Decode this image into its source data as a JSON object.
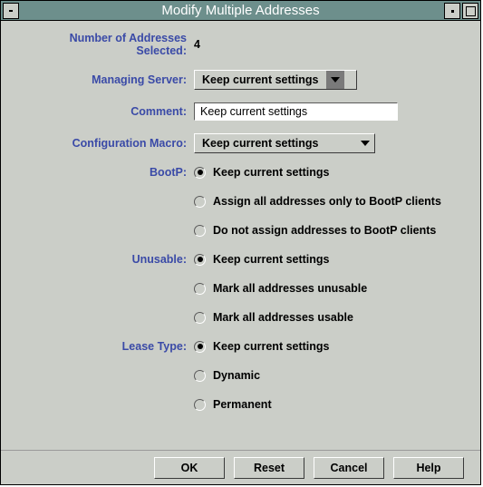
{
  "title": "Modify Multiple Addresses",
  "fields": {
    "count_label": "Number of Addresses Selected:",
    "count_value": "4",
    "server_label": "Managing Server:",
    "server_value": "Keep current settings",
    "comment_label": "Comment:",
    "comment_value": "Keep current settings",
    "macro_label": "Configuration Macro:",
    "macro_value": "Keep current settings"
  },
  "bootp": {
    "label": "BootP:",
    "options": [
      "Keep current settings",
      "Assign all addresses only to BootP clients",
      "Do not assign addresses to BootP clients"
    ],
    "selected": 0
  },
  "unusable": {
    "label": "Unusable:",
    "options": [
      "Keep current settings",
      "Mark all addresses unusable",
      "Mark all addresses usable"
    ],
    "selected": 0
  },
  "lease": {
    "label": "Lease Type:",
    "options": [
      "Keep current settings",
      "Dynamic",
      "Permanent"
    ],
    "selected": 0
  },
  "buttons": {
    "ok": "OK",
    "reset": "Reset",
    "cancel": "Cancel",
    "help": "Help"
  }
}
